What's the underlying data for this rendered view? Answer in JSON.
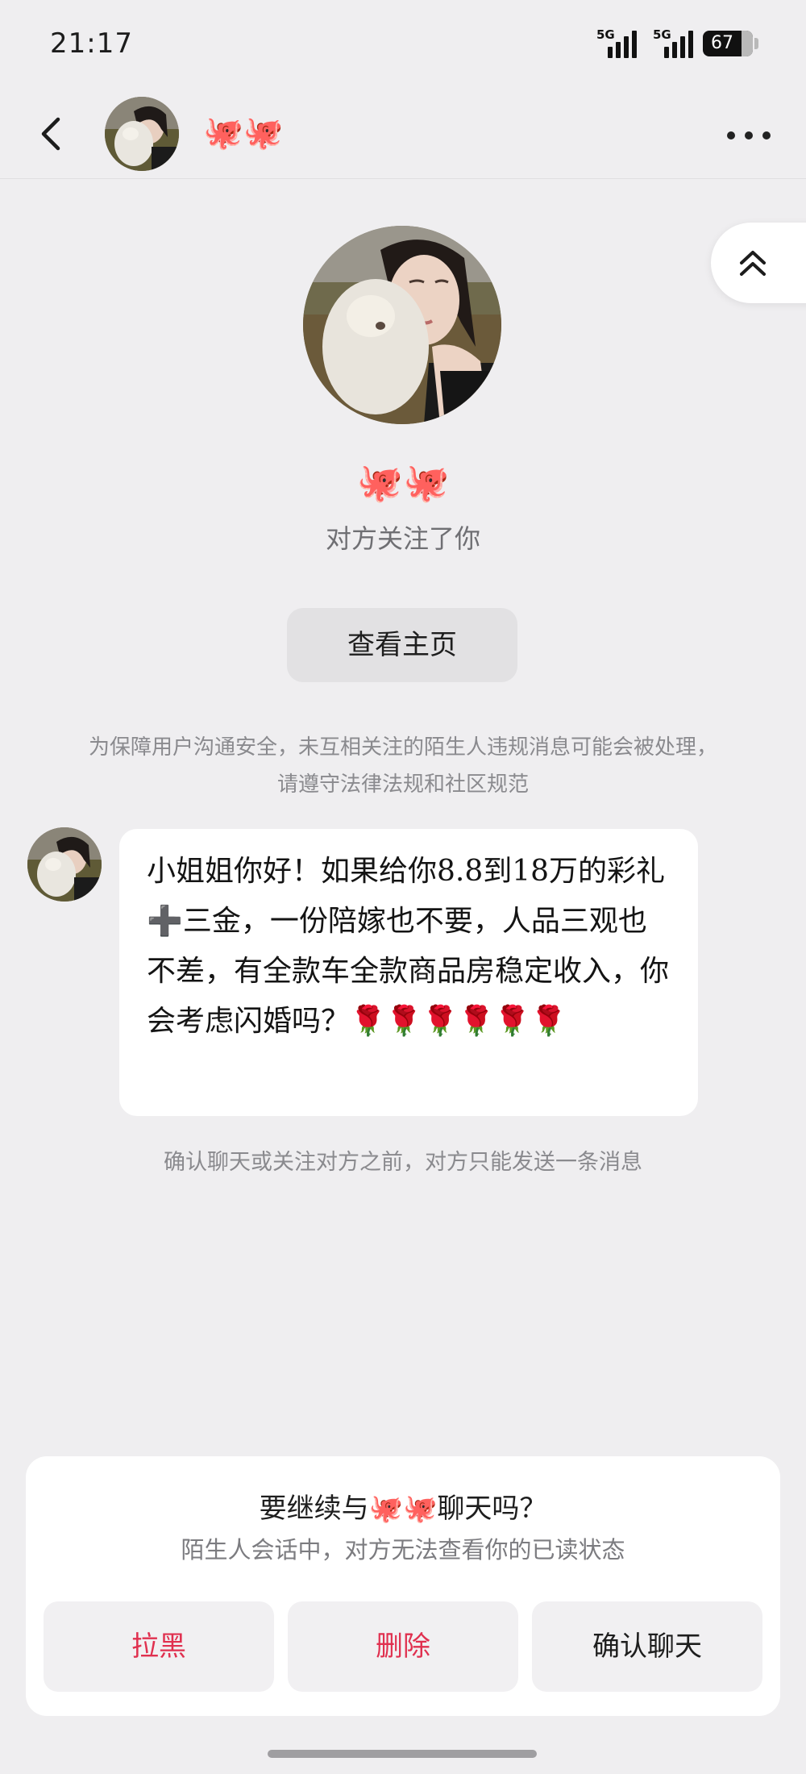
{
  "status_bar": {
    "time": "21:17",
    "network_1": "5G",
    "network_2": "5G",
    "battery": "67"
  },
  "header": {
    "contact_name": "🐙🐙"
  },
  "profile": {
    "name": "🐙🐙",
    "follow_status": "对方关注了你",
    "view_home_label": "查看主页"
  },
  "safety_notice": "为保障用户沟通安全，未互相关注的陌生人违规消息可能会被处理，请遵守法律法规和社区规范",
  "messages": [
    {
      "text": "小姐姐你好！如果给你8.8到18万的彩礼➕三金，一份陪嫁也不要，人品三观也不差，有全款车全款商品房稳定收入，你会考虑闪婚吗？🌹🌹🌹🌹🌹🌹"
    }
  ],
  "limit_notice": "确认聊天或关注对方之前，对方只能发送一条消息",
  "confirm_panel": {
    "title_prefix": "要继续与",
    "title_name": "🐙🐙",
    "title_suffix": "聊天吗？",
    "subtitle": "陌生人会话中，对方无法查看你的已读状态",
    "block_label": "拉黑",
    "delete_label": "删除",
    "confirm_label": "确认聊天"
  },
  "colors": {
    "background": "#efeef0",
    "accent_red": "#e0304f",
    "name_red": "#e24a3b"
  },
  "icons": [
    "back-arrow-icon",
    "more-icon",
    "double-chevron-up-icon",
    "signal-icon",
    "battery-icon"
  ]
}
